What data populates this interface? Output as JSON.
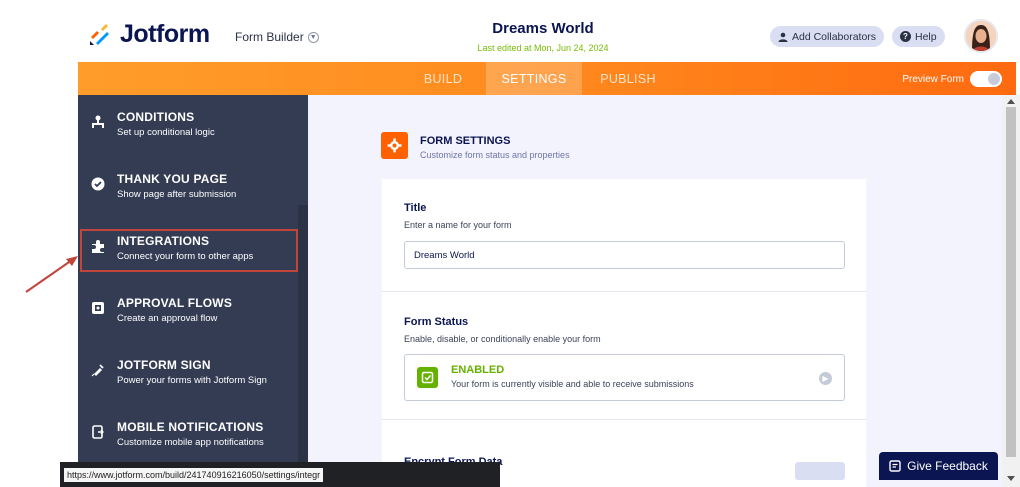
{
  "header": {
    "logo_text": "Jotform",
    "form_builder_label": "Form Builder",
    "form_title": "Dreams World",
    "last_edited": "Last edited at Mon, Jun 24, 2024",
    "collaborators_label": "Add Collaborators",
    "help_label": "Help"
  },
  "nav": {
    "tabs": [
      {
        "label": "BUILD"
      },
      {
        "label": "SETTINGS"
      },
      {
        "label": "PUBLISH"
      }
    ],
    "active_tab": "SETTINGS",
    "preview_label": "Preview Form"
  },
  "sidebar": {
    "items": [
      {
        "title": "CONDITIONS",
        "desc": "Set up conditional logic",
        "icon": "conditions-icon"
      },
      {
        "title": "THANK YOU PAGE",
        "desc": "Show page after submission",
        "icon": "check-circle-icon"
      },
      {
        "title": "INTEGRATIONS",
        "desc": "Connect your form to other apps",
        "icon": "puzzle-icon"
      },
      {
        "title": "APPROVAL FLOWS",
        "desc": "Create an approval flow",
        "icon": "approval-icon"
      },
      {
        "title": "JOTFORM SIGN",
        "desc": "Power your forms with Jotform Sign",
        "icon": "pen-icon"
      },
      {
        "title": "MOBILE NOTIFICATIONS",
        "desc": "Customize mobile app notifications",
        "icon": "mobile-icon"
      }
    ]
  },
  "main": {
    "section_title": "FORM SETTINGS",
    "section_subtitle": "Customize form status and properties",
    "title_field": {
      "label": "Title",
      "desc": "Enter a name for your form",
      "value": "Dreams World"
    },
    "status_field": {
      "label": "Form Status",
      "desc": "Enable, disable, or conditionally enable your form",
      "status_title": "ENABLED",
      "status_desc": "Your form is currently visible and able to receive submissions"
    },
    "encrypt_label": "Encrypt Form Data"
  },
  "feedback_label": "Give Feedback",
  "status_url": "https://www.jotform.com/build/241740916216050/settings/integr",
  "colors": {
    "accent_orange": "#ff6100",
    "sidebar_bg": "#343c54",
    "enabled_green": "#64b200",
    "navy": "#0a1551",
    "highlight_red": "#c0463c"
  }
}
